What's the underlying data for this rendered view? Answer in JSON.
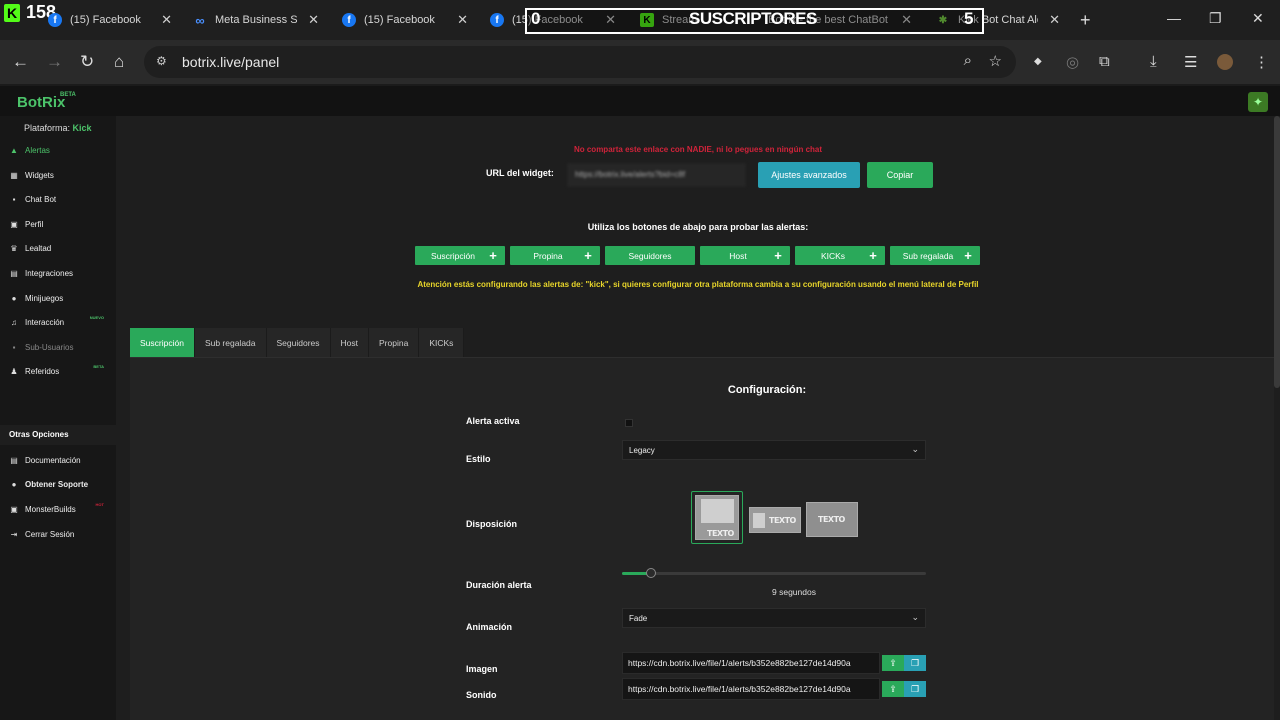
{
  "browser": {
    "badge_count": "158",
    "tabs": [
      {
        "title": "(15) Facebook",
        "icon": "facebook-icon"
      },
      {
        "title": "Meta Business Su",
        "icon": "meta-icon"
      },
      {
        "title": "(15) Facebook",
        "icon": "facebook-icon"
      },
      {
        "title": "(15) Facebook",
        "icon": "facebook-icon"
      },
      {
        "title": "Stream",
        "icon": "kick-icon"
      },
      {
        "title": "Botrix - the best ChatBot",
        "icon": "botrix-icon"
      },
      {
        "title": "Kick Bot Chat Alerts",
        "icon": "botrix-icon"
      }
    ],
    "overlay": {
      "left": "0",
      "title": "SUSCRIPTORES",
      "right": "5"
    },
    "url": "botrix.live/panel"
  },
  "app": {
    "brand": "BotRix",
    "brand_tag": "BETA",
    "platform_label": "Plataforma:",
    "platform_value": "Kick",
    "sidebar": [
      {
        "label": "Alertas",
        "icon": "alert-icon"
      },
      {
        "label": "Widgets",
        "icon": "grid-icon"
      },
      {
        "label": "Chat Bot",
        "icon": "chat-icon"
      },
      {
        "label": "Perfil",
        "icon": "profile-icon"
      },
      {
        "label": "Lealtad",
        "icon": "trophy-icon"
      },
      {
        "label": "Integraciones",
        "icon": "integrations-icon"
      },
      {
        "label": "Minijuegos",
        "icon": "gamepad-icon"
      },
      {
        "label": "Interacción",
        "icon": "music-icon",
        "badge": "NUEVO"
      },
      {
        "label": "Sub-Usuarios",
        "icon": "users-icon"
      },
      {
        "label": "Referidos",
        "icon": "referrals-icon",
        "badge": "BETA"
      }
    ],
    "other_title": "Otras Opciones",
    "other": [
      {
        "label": "Documentación",
        "icon": "docs-icon"
      },
      {
        "label": "Obtener Soporte",
        "icon": "discord-icon"
      },
      {
        "label": "MonsterBuilds",
        "icon": "monster-icon",
        "badge": "HOT"
      },
      {
        "label": "Cerrar Sesión",
        "icon": "logout-icon"
      }
    ]
  },
  "main": {
    "warning": "No comparta este enlace con NADIE, ni lo pegues en ningún chat",
    "url_label": "URL del widget:",
    "url_value": "https://botrix.live/alerts?bid=c8f",
    "btn_advanced": "Ajustes avanzados",
    "btn_copy": "Copiar",
    "test_title": "Utiliza los botones de abajo para probar las alertas:",
    "test_buttons": [
      "Suscripción",
      "Propina",
      "Seguidores",
      "Host",
      "KICKs",
      "Sub regalada"
    ],
    "attention": "Atención estás configurando las alertas de: \"kick\", si quieres configurar otra plataforma cambia a su configuración usando el menú lateral de Perfil",
    "tabs": [
      "Suscripción",
      "Sub regalada",
      "Seguidores",
      "Host",
      "Propina",
      "KICKs"
    ],
    "config": {
      "title": "Configuración:",
      "active_label": "Alerta activa",
      "style_label": "Estilo",
      "style_value": "Legacy",
      "layout_label": "Disposición",
      "layout_text": "TEXTO",
      "duration_label": "Duración alerta",
      "duration_value": 9,
      "duration_max": 100,
      "duration_text": "9 segundos",
      "animation_label": "Animación",
      "animation_value": "Fade",
      "image_label": "Imagen",
      "image_url": "https://cdn.botrix.live/file/1/alerts/b352e882be127de14d90a",
      "sound_label": "Sonido",
      "sound_url": "https://cdn.botrix.live/file/1/alerts/b352e882be127de14d90a"
    }
  },
  "colors": {
    "accent": "#2aa95a",
    "info": "#29a0b4",
    "warning_red": "#d0233a",
    "attention_yellow": "#e8d52a"
  }
}
